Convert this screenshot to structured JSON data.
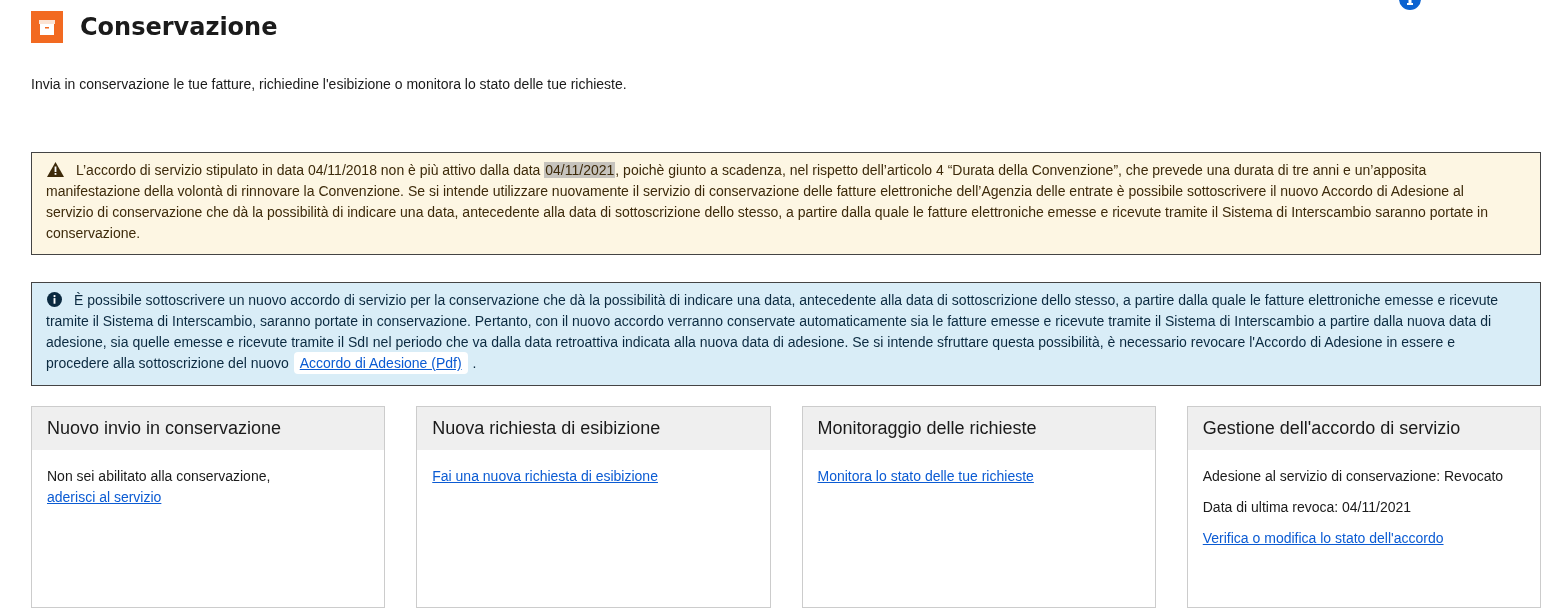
{
  "page": {
    "title": "Conservazione",
    "subtitle": "Invia in conservazione le tue fatture, richiedine l'esibizione o monitora lo stato delle tue richieste."
  },
  "warning": {
    "text_before": "L’accordo di servizio stipulato in data 04/11/2018 non è più attivo dalla data ",
    "highlighted": "04/11/2021",
    "text_after": ", poichè giunto a scadenza, nel rispetto dell’articolo 4 “Durata della Convenzione”, che prevede una durata di tre anni e un’apposita manifestazione della volontà di rinnovare la Convenzione. Se si intende utilizzare nuovamente il servizio di conservazione delle fatture elettroniche dell’Agenzia delle entrate è possibile sottoscrivere il nuovo Accordo di Adesione al servizio di conservazione che dà la possibilità di indicare una data, antecedente alla data di sottoscrizione dello stesso, a partire dalla quale le fatture elettroniche emesse e ricevute tramite il Sistema di Interscambio saranno portate in conservazione."
  },
  "info": {
    "text": "È possibile sottoscrivere un nuovo accordo di servizio per la conservazione che dà la possibilità di indicare una data, antecedente alla data di sottoscrizione dello stesso, a partire dalla quale le fatture elettroniche emesse e ricevute tramite il Sistema di Interscambio, saranno portate in conservazione. Pertanto, con il nuovo accordo verranno conservate automaticamente sia le fatture emesse e ricevute tramite il Sistema di Interscambio a partire dalla nuova data di adesione, sia quelle emesse e ricevute tramite il SdI nel periodo che va dalla data retroattiva indicata alla nuova data di adesione. Se si intende sfruttare questa possibilità, è necessario revocare l'Accordo di Adesione in essere e procedere alla sottoscrizione del nuovo",
    "link": "Accordo di Adesione (Pdf)",
    "text_end": "."
  },
  "cards": [
    {
      "title": "Nuovo invio in conservazione",
      "items": [
        {
          "kind": "text_link",
          "text": "Non sei abilitato alla conservazione,",
          "link": "aderisci al servizio"
        }
      ]
    },
    {
      "title": "Nuova richiesta di esibizione",
      "items": [
        {
          "kind": "link",
          "text": "Fai una nuova richiesta di esibizione"
        }
      ]
    },
    {
      "title": "Monitoraggio delle richieste",
      "items": [
        {
          "kind": "link",
          "text": "Monitora lo stato delle tue richieste"
        }
      ]
    },
    {
      "title": "Gestione dell'accordo di servizio",
      "items": [
        {
          "kind": "text",
          "text": "Adesione al servizio di conservazione: Revocato"
        },
        {
          "kind": "text",
          "text": "Data di ultima revoca: 04/11/2021"
        },
        {
          "kind": "link",
          "text": "Verifica o modifica lo stato dell'accordo"
        }
      ]
    }
  ]
}
